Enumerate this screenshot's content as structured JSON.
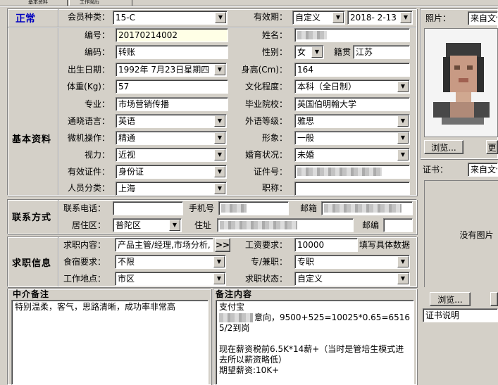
{
  "tabs": [
    "基本资料",
    "工作简历"
  ],
  "status": "正常",
  "sections": {
    "basic": "基本资料",
    "contact": "联系方式",
    "job": "求职信息",
    "broker_note": "中介备注",
    "memo": "备注内容"
  },
  "labels": {
    "member_type": "会员种类：",
    "valid": "有效期：",
    "number": "编号：",
    "name": "姓名：",
    "code": "编码：",
    "gender": "性别：",
    "native": "籍贯",
    "birth": "出生日期：",
    "height": "身高(Cm)：",
    "weight": "体重(Kg)：",
    "education": "文化程度：",
    "major": "专业：",
    "school": "毕业院校：",
    "language": "通晓语言：",
    "foreign": "外语等级：",
    "computer": "微机操作：",
    "image": "形象：",
    "vision": "视力：",
    "marital": "婚育状况：",
    "cert": "有效证件：",
    "cert_no": "证件号：",
    "category": "人员分类：",
    "title": "职称：",
    "phone": "联系电话：",
    "mobile": "手机号",
    "email": "邮箱",
    "district": "居住区：",
    "address": "住址",
    "zip": "邮编",
    "job_content": "求职内容：",
    "salary": "工资要求：",
    "lodging": "食宿要求：",
    "fulltime": "专/兼职：",
    "location": "工作地点：",
    "job_status": "求职状态：",
    "photo": "照片：",
    "certificate": "证书："
  },
  "values": {
    "member_type": "15-C",
    "valid_type": "自定义",
    "valid_date": "2018- 2-13",
    "number": "20170214002",
    "code": "转账",
    "gender": "女",
    "native": "江苏",
    "birth": "1992年 7月23日星期四",
    "height": "164",
    "weight": "57",
    "education": "本科（全日制）",
    "major": "市场营销传播",
    "school": "英国伯明翰大学",
    "language": "英语",
    "foreign": "雅思",
    "computer": "精通",
    "image": "一般",
    "vision": "近视",
    "marital": "未婚",
    "cert": "身份证",
    "category": "上海",
    "district": "普陀区",
    "job_content": "产品主管/经理,市场分析,",
    "salary": "10000",
    "salary_hint": "填写具体数据",
    "lodging": "不限",
    "fulltime": "专职",
    "location": "市区",
    "job_status": "自定义",
    "photo_source": "来自文件",
    "cert_source": "来自文件",
    "no_image": "没有图片",
    "cert_desc": "证书说明"
  },
  "buttons": {
    "more": ">>",
    "browse": "浏览...",
    "update": "更",
    "browse2": "浏览..."
  },
  "broker_note": "特别温柔，客气，思路清晰，成功率非常高",
  "memo_lines": [
    "支付宝",
    "意向，9500+525=10025*0.65=6516",
    "5/2到岗",
    "",
    "现在薪资税前6.5K*14薪+（当时是管培生模式进",
    "去所以薪资略低）",
    "期望薪资:10K+"
  ]
}
